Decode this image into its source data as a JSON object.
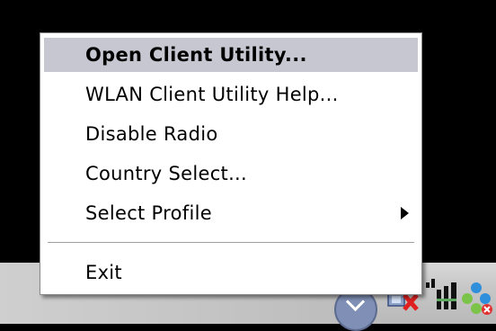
{
  "menu": {
    "items": [
      {
        "label": "Open Client Utility...",
        "highlighted": true,
        "bold": true
      },
      {
        "label": "WLAN Client Utility Help...",
        "highlighted": false,
        "bold": false
      },
      {
        "label": "Disable Radio",
        "highlighted": false,
        "bold": false
      },
      {
        "label": "Country Select...",
        "highlighted": false,
        "bold": false
      },
      {
        "label": "Select Profile",
        "highlighted": false,
        "bold": false,
        "submenu": true
      }
    ],
    "exit_label": "Exit"
  },
  "tray": {
    "icons": [
      "show-hidden-icons-chevron-icon",
      "network-disconnected-icon",
      "wlan-signal-icon",
      "wlan-utility-status-icon"
    ]
  },
  "colors": {
    "highlight": "#c7c7d2",
    "menu_bg": "#ffffff",
    "desktop": "#000000",
    "taskbar": "#c7c7c7"
  }
}
